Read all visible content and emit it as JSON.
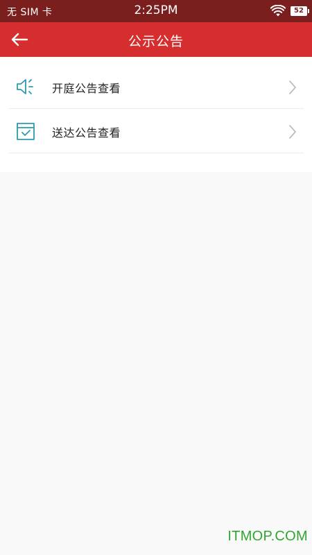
{
  "status_bar": {
    "carrier": "无 SIM 卡",
    "time": "2:25PM",
    "battery": "52",
    "wifi_icon": "wifi-icon"
  },
  "header": {
    "title": "公示公告",
    "back_icon": "arrow-left-icon"
  },
  "menu": {
    "items": [
      {
        "label": "开庭公告查看",
        "icon": "speaker-icon"
      },
      {
        "label": "送达公告查看",
        "icon": "delivery-box-icon"
      }
    ]
  },
  "watermark": "ITMOP.COM",
  "colors": {
    "status_bar": "#7a1e1e",
    "nav_bar": "#d62e2e",
    "icon_teal": "#2a9bb0",
    "watermark": "#2fa62f"
  }
}
